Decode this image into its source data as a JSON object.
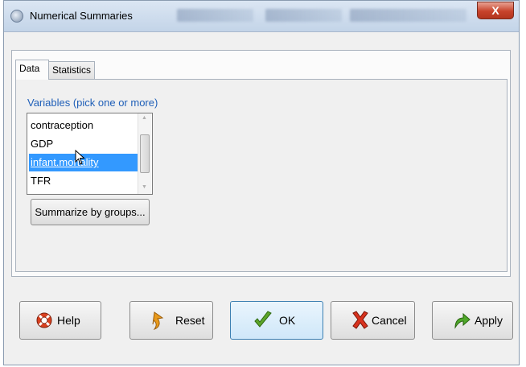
{
  "window": {
    "title": "Numerical Summaries",
    "close_label": "X"
  },
  "tabs": [
    {
      "label": "Data",
      "active": true
    },
    {
      "label": "Statistics",
      "active": false
    }
  ],
  "data_tab": {
    "variables_label": "Variables (pick one or more)",
    "variables": [
      {
        "name": "contraception",
        "selected": false
      },
      {
        "name": "GDP",
        "selected": false
      },
      {
        "name": "infant.mortality",
        "selected": true
      },
      {
        "name": "TFR",
        "selected": false
      }
    ],
    "summarize_button": "Summarize by groups..."
  },
  "buttons": {
    "help": {
      "label": "Help",
      "icon": "lifebuoy-icon"
    },
    "reset": {
      "label": "Reset",
      "icon": "undo-arrow-icon"
    },
    "ok": {
      "label": "OK",
      "icon": "checkmark-icon"
    },
    "cancel": {
      "label": "Cancel",
      "icon": "red-x-icon"
    },
    "apply": {
      "label": "Apply",
      "icon": "green-arrow-icon"
    }
  },
  "colors": {
    "selection": "#3399ff",
    "label_blue": "#1f5fb8",
    "ok_highlight": "#cfe7f9"
  }
}
